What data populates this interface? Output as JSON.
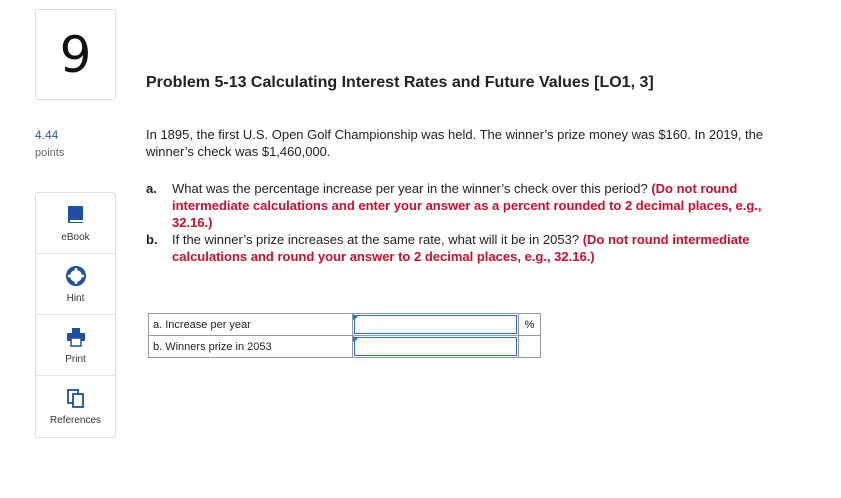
{
  "question": {
    "number": "9",
    "points_value": "4.44",
    "points_label": "points"
  },
  "tools": [
    {
      "label": "eBook",
      "icon": "book-icon"
    },
    {
      "label": "Hint",
      "icon": "lifebuoy-icon"
    },
    {
      "label": "Print",
      "icon": "printer-icon"
    },
    {
      "label": "References",
      "icon": "documents-icon"
    }
  ],
  "problem": {
    "title": "Problem 5-13 Calculating Interest Rates and Future Values [LO1, 3]",
    "intro": "In 1895, the first U.S. Open Golf Championship was held. The winner’s prize money was $160. In 2019, the winner’s check was $1,460,000.",
    "parts": [
      {
        "label": "a.",
        "text": "What was the percentage increase per year in the winner’s check over this period? ",
        "instruction": "(Do not round intermediate calculations and enter your answer as a percent rounded to 2 decimal places, e.g., 32.16.)"
      },
      {
        "label": "b.",
        "text": "If the winner’s prize increases at the same rate, what will it be in 2053? ",
        "instruction": "(Do not round intermediate calculations and round your answer to 2 decimal places, e.g., 32.16.)"
      }
    ]
  },
  "answers": [
    {
      "label": "a. Increase per year",
      "value": "",
      "unit": "%"
    },
    {
      "label": "b. Winners prize in 2053",
      "value": "",
      "unit": ""
    }
  ],
  "colors": {
    "accent_blue": "#2a6fd1",
    "instruction_red": "#c8102e",
    "icon_blue": "#1e4fa0"
  }
}
